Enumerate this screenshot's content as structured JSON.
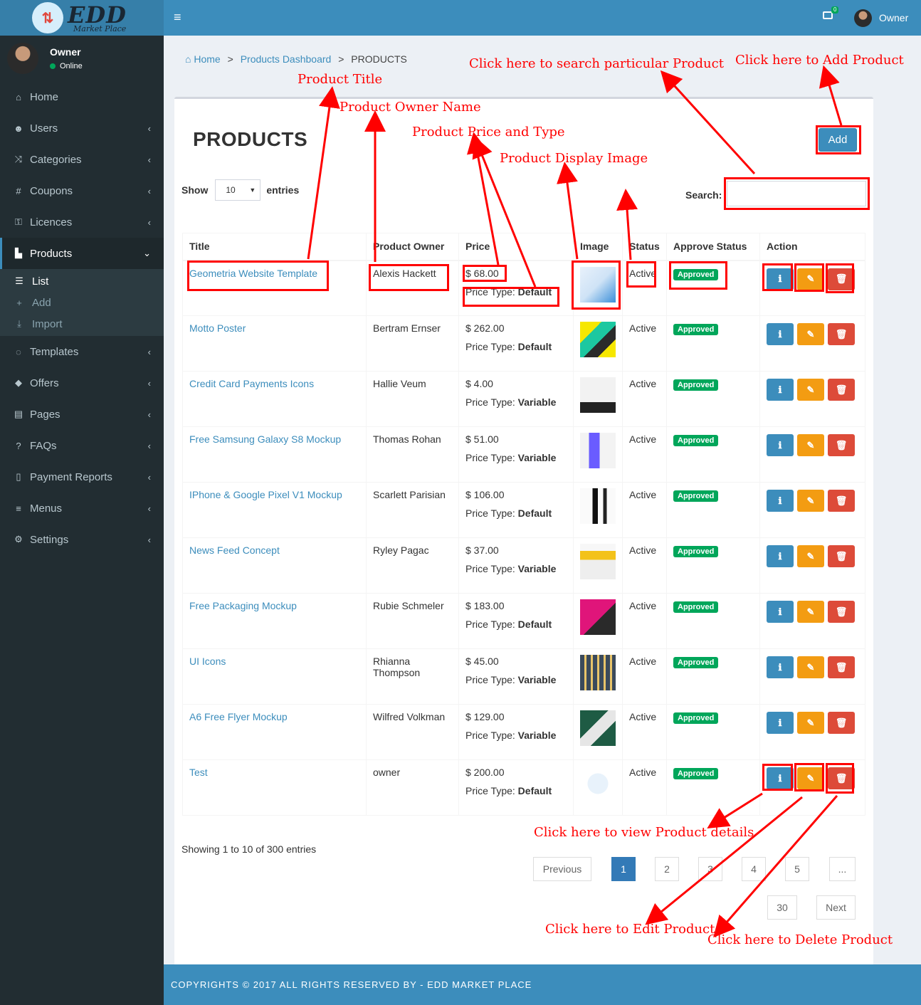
{
  "brand": {
    "logo_main": "EDD",
    "logo_sub": "Market Place"
  },
  "sidebar": {
    "user_name": "Owner",
    "user_status": "Online",
    "items": [
      {
        "label": "Home",
        "icon": "home-icon"
      },
      {
        "label": "Users",
        "icon": "users-icon"
      },
      {
        "label": "Categories",
        "icon": "random-icon"
      },
      {
        "label": "Coupons",
        "icon": "hashtag-icon"
      },
      {
        "label": "Licences",
        "icon": "key-icon"
      },
      {
        "label": "Products",
        "icon": "shopping-bag-icon"
      },
      {
        "label": "Templates",
        "icon": "comment-icon"
      },
      {
        "label": "Offers",
        "icon": "tags-icon"
      },
      {
        "label": "Pages",
        "icon": "file-icon"
      },
      {
        "label": "FAQs",
        "icon": "question-icon"
      },
      {
        "label": "Payment Reports",
        "icon": "file-outline-icon"
      },
      {
        "label": "Menus",
        "icon": "bars-icon"
      },
      {
        "label": "Settings",
        "icon": "cogs-icon"
      }
    ],
    "products_sub": [
      {
        "label": "List",
        "icon": "list-icon"
      },
      {
        "label": "Add",
        "icon": "plus-icon"
      },
      {
        "label": "Import",
        "icon": "download-icon"
      }
    ]
  },
  "header": {
    "user": "Owner",
    "mail_count": "0"
  },
  "breadcrumb": {
    "home": "Home",
    "dashboard": "Products Dashboard",
    "current": "PRODUCTS",
    "sep": ">"
  },
  "page": {
    "title": "PRODUCTS",
    "add_label": "Add",
    "show_label": "Show",
    "entries_label": "entries",
    "page_size": "10",
    "search_label": "Search:",
    "search_value": ""
  },
  "table": {
    "headers": [
      "Title",
      "Product Owner",
      "Price",
      "Image",
      "Status",
      "Approve Status",
      "Action"
    ],
    "price_type_label": "Price Type:",
    "rows": [
      {
        "title": "Geometria Website Template",
        "owner": "Alexis Hackett",
        "price": "$ 68.00",
        "type": "Default",
        "status": "Active",
        "approve": "Approved"
      },
      {
        "title": "Motto Poster",
        "owner": "Bertram Ernser",
        "price": "$ 262.00",
        "type": "Default",
        "status": "Active",
        "approve": "Approved"
      },
      {
        "title": "Credit Card Payments Icons",
        "owner": "Hallie Veum",
        "price": "$ 4.00",
        "type": "Variable",
        "status": "Active",
        "approve": "Approved"
      },
      {
        "title": "Free Samsung Galaxy S8 Mockup",
        "owner": "Thomas Rohan",
        "price": "$ 51.00",
        "type": "Variable",
        "status": "Active",
        "approve": "Approved"
      },
      {
        "title": "IPhone & Google Pixel V1 Mockup",
        "owner": "Scarlett Parisian",
        "price": "$ 106.00",
        "type": "Default",
        "status": "Active",
        "approve": "Approved"
      },
      {
        "title": "News Feed Concept",
        "owner": "Ryley Pagac",
        "price": "$ 37.00",
        "type": "Variable",
        "status": "Active",
        "approve": "Approved"
      },
      {
        "title": "Free Packaging Mockup",
        "owner": "Rubie Schmeler",
        "price": "$ 183.00",
        "type": "Default",
        "status": "Active",
        "approve": "Approved"
      },
      {
        "title": "UI Icons",
        "owner": "Rhianna Thompson",
        "price": "$ 45.00",
        "type": "Variable",
        "status": "Active",
        "approve": "Approved"
      },
      {
        "title": "A6 Free Flyer Mockup",
        "owner": "Wilfred Volkman",
        "price": "$ 129.00",
        "type": "Variable",
        "status": "Active",
        "approve": "Approved"
      },
      {
        "title": "Test",
        "owner": "owner",
        "price": "$ 200.00",
        "type": "Default",
        "status": "Active",
        "approve": "Approved"
      }
    ]
  },
  "pagination": {
    "info": "Showing 1 to 10 of 300 entries",
    "previous": "Previous",
    "next": "Next",
    "pages": [
      "1",
      "2",
      "3",
      "4",
      "5",
      "...",
      "30"
    ]
  },
  "footer": {
    "text": "COPYRIGHTS © 2017 ALL RIGHTS RESERVED BY - EDD MARKET PLACE"
  },
  "annotations": {
    "product_title": "Product Title",
    "owner_name": "Product Owner Name",
    "price_type": "Product Price and Type",
    "display_image": "Product Display Image",
    "search": "Click here to search particular Product",
    "add": "Click here to Add Product",
    "view": "Click here to view Product details",
    "edit": "Click here to Edit Product",
    "delete": "Click here to Delete Product"
  },
  "colors": {
    "primary": "#3c8dbc",
    "sidebar": "#222d32",
    "success": "#00a65a",
    "warning": "#f39c12",
    "danger": "#dd4b39",
    "annotation": "#ff0000"
  }
}
